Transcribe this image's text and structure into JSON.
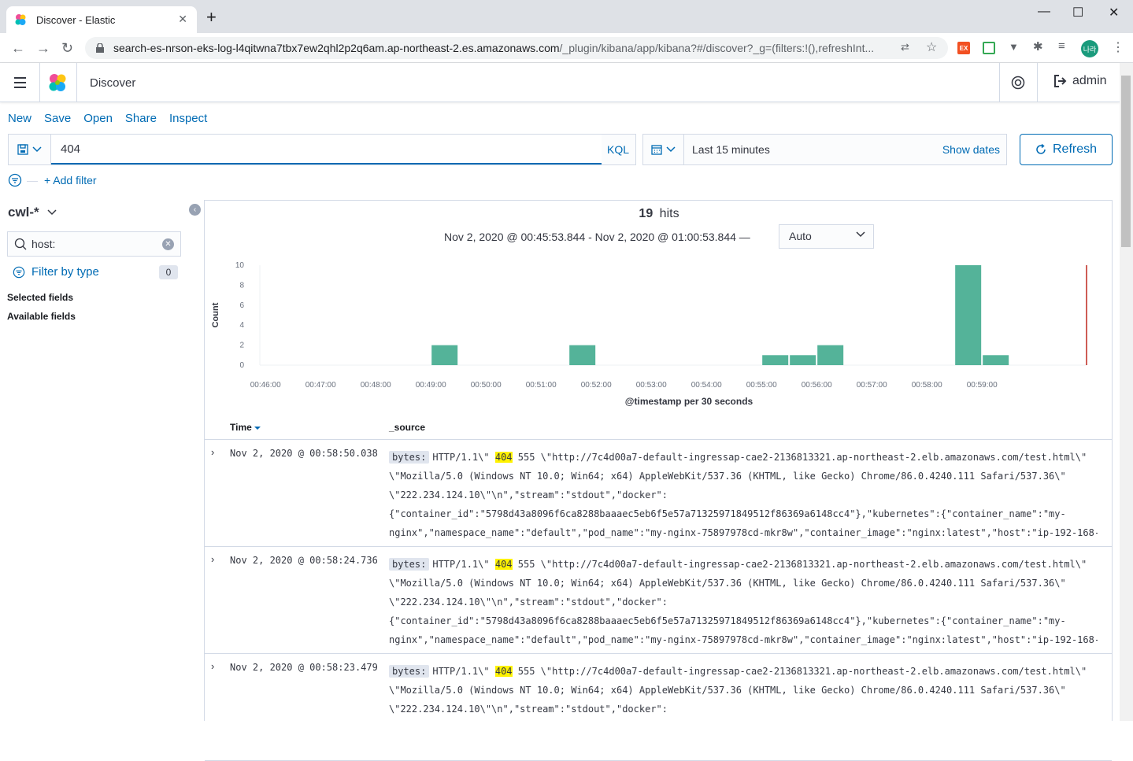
{
  "browser": {
    "tab_title": "Discover - Elastic",
    "url_main": "search-es-nrson-eks-log-l4qitwna7tbx7ew2qhl2p2q6am.ap-northeast-2.es.amazonaws.com",
    "url_rest": "/_plugin/kibana/app/kibana?#/discover?_g=(filters:!(),refreshInt...",
    "avatar_text": "나라",
    "ext_label": "EX"
  },
  "header": {
    "breadcrumb": "Discover",
    "user": "admin"
  },
  "topnav": [
    "New",
    "Save",
    "Open",
    "Share",
    "Inspect"
  ],
  "query": {
    "value": "404",
    "language": "KQL",
    "date_label": "Last 15 minutes",
    "show_dates": "Show dates",
    "refresh": "Refresh",
    "add_filter": "+ Add filter"
  },
  "sidebar": {
    "index_pattern": "cwl-*",
    "field_search": "host:",
    "filter_by_type": "Filter by type",
    "filter_count": "0",
    "selected_fields": "Selected fields",
    "available_fields": "Available fields"
  },
  "summary": {
    "hits_count": "19",
    "hits_label": "hits",
    "range": "Nov 2, 2020 @ 00:45:53.844 - Nov 2, 2020 @ 01:00:53.844 —",
    "interval": "Auto"
  },
  "chart_data": {
    "type": "bar",
    "xlabel": "@timestamp per 30 seconds",
    "ylabel": "Count",
    "ylim": [
      0,
      10
    ],
    "yticks": [
      "0",
      "2",
      "4",
      "6",
      "8",
      "10"
    ],
    "xticks": [
      "00:46:00",
      "00:47:00",
      "00:48:00",
      "00:49:00",
      "00:50:00",
      "00:51:00",
      "00:52:00",
      "00:53:00",
      "00:54:00",
      "00:55:00",
      "00:56:00",
      "00:57:00",
      "00:58:00",
      "00:59:00"
    ],
    "bars": [
      {
        "x": "00:49:00",
        "value": 2
      },
      {
        "x": "00:51:30",
        "value": 2
      },
      {
        "x": "00:55:00",
        "value": 1
      },
      {
        "x": "00:55:30",
        "value": 1
      },
      {
        "x": "00:56:00",
        "value": 2
      },
      {
        "x": "00:58:30",
        "value": 10
      },
      {
        "x": "00:59:00",
        "value": 1
      }
    ],
    "now_marker": "01:00:53.844",
    "bar_color": "#54b399",
    "marker_color": "#bd271e"
  },
  "table": {
    "col_time": "Time",
    "col_source": "_source",
    "rows": [
      {
        "time": "Nov 2, 2020 @ 00:58:50.038",
        "key": "bytes:",
        "pre": "HTTP/1.1\\\"",
        "hl": "404",
        "post": "555 \\\"http://7c4d00a7-default-ingressap-cae2-2136813321.ap-northeast-2.elb.amazonaws.com/test.html\\\"",
        "l2": "\\\"Mozilla/5.0 (Windows NT 10.0; Win64; x64) AppleWebKit/537.36 (KHTML, like Gecko) Chrome/86.0.4240.111 Safari/537.36\\\"",
        "l3": "\\\"222.234.124.10\\\"\\n\",\"stream\":\"stdout\",\"docker\":",
        "l4": "{\"container_id\":\"5798d43a8096f6ca8288baaaec5eb6f5e57a71325971849512f86369a6148cc4\"},\"kubernetes\":{\"container_name\":\"my-",
        "l5": "nginx\",\"namespace_name\":\"default\",\"pod_name\":\"my-nginx-75897978cd-mkr8w\",\"container_image\":\"nginx:latest\",\"host\":\"ip-192-168-"
      },
      {
        "time": "Nov 2, 2020 @ 00:58:24.736",
        "key": "bytes:",
        "pre": "HTTP/1.1\\\"",
        "hl": "404",
        "post": "555 \\\"http://7c4d00a7-default-ingressap-cae2-2136813321.ap-northeast-2.elb.amazonaws.com/test.html\\\"",
        "l2": "\\\"Mozilla/5.0 (Windows NT 10.0; Win64; x64) AppleWebKit/537.36 (KHTML, like Gecko) Chrome/86.0.4240.111 Safari/537.36\\\"",
        "l3": "\\\"222.234.124.10\\\"\\n\",\"stream\":\"stdout\",\"docker\":",
        "l4": "{\"container_id\":\"5798d43a8096f6ca8288baaaec5eb6f5e57a71325971849512f86369a6148cc4\"},\"kubernetes\":{\"container_name\":\"my-",
        "l5": "nginx\",\"namespace_name\":\"default\",\"pod_name\":\"my-nginx-75897978cd-mkr8w\",\"container_image\":\"nginx:latest\",\"host\":\"ip-192-168-"
      },
      {
        "time": "Nov 2, 2020 @ 00:58:23.479",
        "key": "bytes:",
        "pre": "HTTP/1.1\\\"",
        "hl": "404",
        "post": "555 \\\"http://7c4d00a7-default-ingressap-cae2-2136813321.ap-northeast-2.elb.amazonaws.com/test.html\\\"",
        "l2": "\\\"Mozilla/5.0 (Windows NT 10.0; Win64; x64) AppleWebKit/537.36 (KHTML, like Gecko) Chrome/86.0.4240.111 Safari/537.36\\\"",
        "l3": "\\\"222.234.124.10\\\"\\n\",\"stream\":\"stdout\",\"docker\":",
        "l4": "",
        "l5": ""
      }
    ]
  }
}
